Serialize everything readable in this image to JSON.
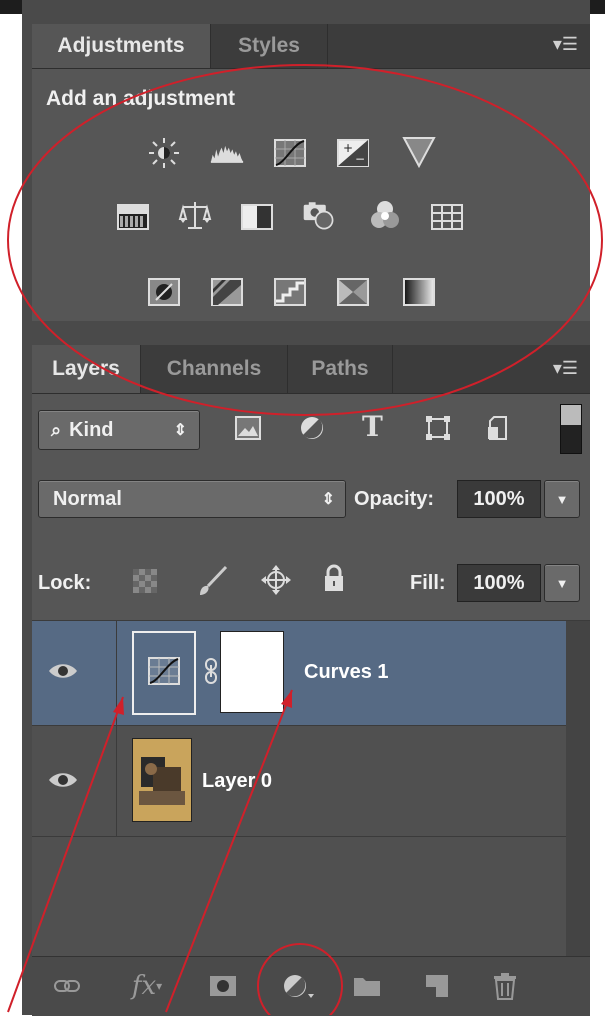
{
  "adjustments_panel": {
    "tabs": [
      {
        "label": "Adjustments",
        "active": true
      },
      {
        "label": "Styles",
        "active": false
      }
    ],
    "heading": "Add an adjustment",
    "icons_row1": [
      "brightness-contrast-icon",
      "levels-icon",
      "curves-icon",
      "exposure-icon",
      "vibrance-icon"
    ],
    "icons_row2": [
      "hue-saturation-icon",
      "color-balance-icon",
      "black-white-icon",
      "photo-filter-icon",
      "channel-mixer-icon",
      "color-lookup-icon"
    ],
    "icons_row3": [
      "invert-icon",
      "posterize-icon",
      "threshold-icon",
      "selective-color-icon",
      "gradient-map-icon"
    ]
  },
  "layers_panel": {
    "tabs": [
      {
        "label": "Layers",
        "active": true
      },
      {
        "label": "Channels",
        "active": false
      },
      {
        "label": "Paths",
        "active": false
      }
    ],
    "filter": {
      "label": "Kind",
      "icons": [
        "pixel-layer-filter-icon",
        "adjustment-layer-filter-icon",
        "type-layer-filter-icon",
        "shape-layer-filter-icon",
        "smart-object-filter-icon"
      ]
    },
    "blend_mode": "Normal",
    "opacity_label": "Opacity:",
    "opacity_value": "100%",
    "lock_label": "Lock:",
    "fill_label": "Fill:",
    "fill_value": "100%",
    "layers": [
      {
        "name": "Curves 1",
        "type": "adjustment",
        "selected": true,
        "visible": true
      },
      {
        "name": "Layer 0",
        "type": "pixel",
        "selected": false,
        "visible": true
      }
    ],
    "bottom_icons": [
      "link-layers-icon",
      "layer-style-icon",
      "add-mask-icon",
      "new-adjustment-layer-icon",
      "new-group-icon",
      "new-layer-icon",
      "delete-layer-icon"
    ]
  },
  "colors": {
    "panel_bg": "#565656",
    "selected_row": "#566a84",
    "annotation_red": "#d0202a"
  }
}
